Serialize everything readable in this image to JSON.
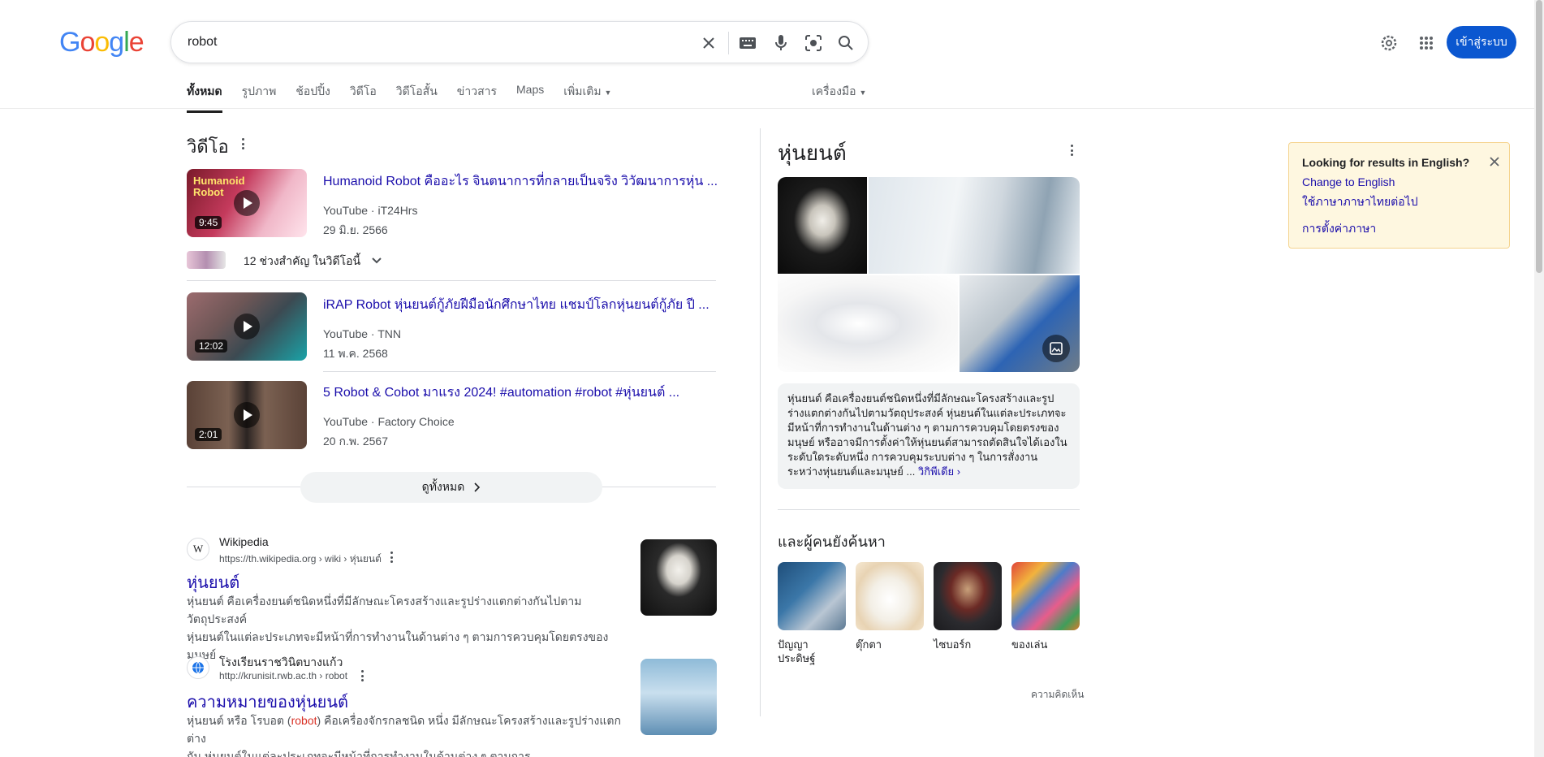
{
  "header": {
    "logo_text": "Google",
    "search_value": "robot",
    "signin_label": "เข้าสู่ระบบ"
  },
  "tabs": [
    {
      "label": "ทั้งหมด",
      "active": true
    },
    {
      "label": "รูปภาพ"
    },
    {
      "label": "ช้อปปิ้ง"
    },
    {
      "label": "วิดีโอ"
    },
    {
      "label": "วิดีโอสั้น"
    },
    {
      "label": "ข่าวสาร"
    },
    {
      "label": "Maps"
    },
    {
      "label": "เพิ่มเติม"
    }
  ],
  "tools_label": "เครื่องมือ",
  "videos": {
    "section_title": "วิดีโอ",
    "items": [
      {
        "title": "Humanoid Robot คืออะไร จินตนาการที่กลายเป็นจริง วิวัฒนาการหุ่น ...",
        "source": "YouTube · iT24Hrs",
        "date": "29 มิ.ย. 2566",
        "duration": "9:45"
      },
      {
        "title": "iRAP Robot หุ่นยนต์กู้ภัยฝีมือนักศึกษาไทย แชมป์โลกหุ่นยนต์กู้ภัย ปี ...",
        "source": "YouTube · TNN",
        "date": "11 พ.ค. 2568",
        "duration": "12:02"
      },
      {
        "title": "5 Robot & Cobot มาแรง 2024! #automation #robot #หุ่นยนต์ ...",
        "source": "YouTube · Factory Choice",
        "date": "20 ก.พ. 2567",
        "duration": "2:01"
      }
    ],
    "key_moments_label": "12 ช่วงสำคัญ ในวิดีโอนี้",
    "see_all_label": "ดูทั้งหมด"
  },
  "results": [
    {
      "site_name": "Wikipedia",
      "url": "https://th.wikipedia.org › wiki › หุ่นยนต์",
      "title": "หุ่นยนต์",
      "snippet_1": "หุ่นยนต์ คือเครื่องยนต์ชนิดหนึ่งที่มีลักษณะโครงสร้างและรูปร่างแตกต่างกันไปตามวัตถุประสงค์",
      "snippet_2": "หุ่นยนต์ในแต่ละประเภทจะมีหน้าที่การทำงานในด้านต่าง ๆ ตามการควบคุมโดยตรงของมนุษย์ ...",
      "favicon_letter": "W"
    },
    {
      "site_name": "โรงเรียนราชวินิตบางแก้ว",
      "url": "http://krunisit.rwb.ac.th › robot",
      "title": "ความหมายของหุ่นยนต์",
      "snippet_1a": "หุ่นยนต์ หรือ โรบอต (",
      "snippet_1b": "robot",
      "snippet_1c": ") คือเครื่องจักรกลชนิด หนึ่ง มีลักษณะโครงสร้างและรูปร่างแตกต่าง",
      "snippet_2": "กัน หุ่นยนต์ในแต่ละประเภทจะมีหน้าที่การทำงานในด้านต่าง ๆ ตามการ ..."
    }
  ],
  "knowledge_panel": {
    "title": "หุ่นยนต์",
    "description": "หุ่นยนต์ คือเครื่องยนต์ชนิดหนึ่งที่มีลักษณะโครงสร้างและรูปร่างแตกต่างกันไปตามวัตถุประสงค์ หุ่นยนต์ในแต่ละประเภทจะมีหน้าที่การทำงานในด้านต่าง ๆ ตามการควบคุมโดยตรงของมนุษย์ หรืออาจมีการตั้งค่าให้หุ่นยนต์สามารถตัดสินใจได้เองในระดับใดระดับหนึ่ง การควบคุมระบบต่าง ๆ ในการสั่งงานระหว่างหุ่นยนต์และมนุษย์ ... ",
    "wiki_link": "วิกิพีเดีย ›",
    "also_search_title": "และผู้คนยังค้นหา",
    "also_search": [
      {
        "label": "ปัญญาประดิษฐ์"
      },
      {
        "label": "ตุ๊กตา"
      },
      {
        "label": "ไซบอร์ก"
      },
      {
        "label": "ของเล่น"
      }
    ],
    "feedback_label": "ความคิดเห็น"
  },
  "english_box": {
    "heading": "Looking for results in English?",
    "change_label": "Change to English",
    "keep_label": "ใช้ภาษาภาษาไทยต่อไป",
    "settings_label": "การตั้งค่าภาษา"
  },
  "colors": {
    "link": "#1a0dab",
    "accent": "#0b57d0",
    "highlight": "#d93025"
  }
}
